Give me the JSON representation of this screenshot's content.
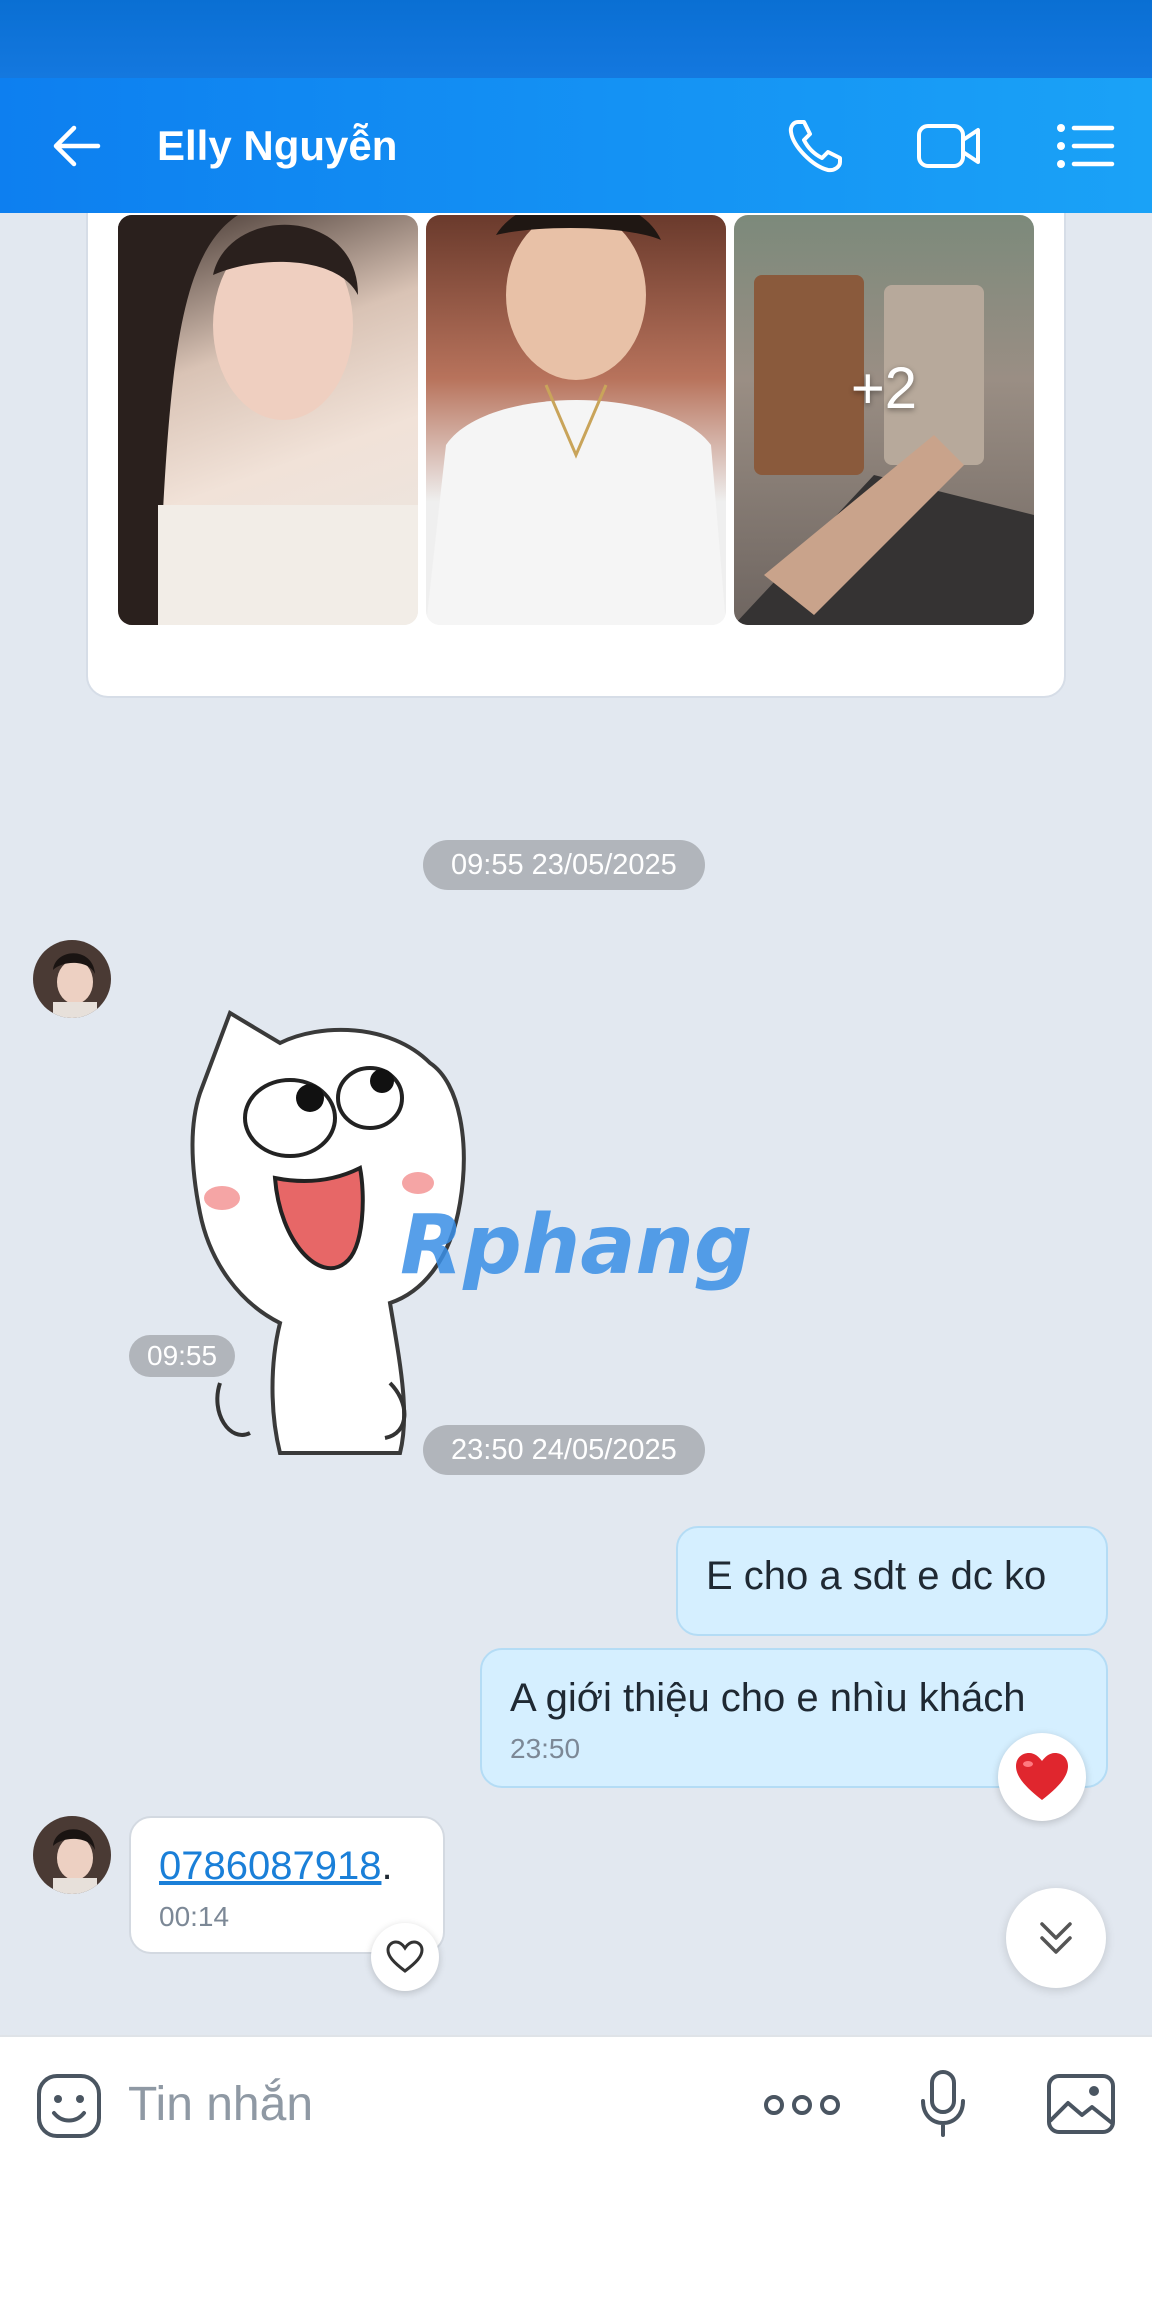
{
  "header": {
    "title": "Elly Nguyễn"
  },
  "album": {
    "more_count": "+2"
  },
  "messages": {
    "date1": "09:55 23/05/2025",
    "sticker_time": "09:55",
    "sticker_watermark": "Rphang",
    "date2": "23:50 24/05/2025",
    "out1": "E cho a sdt e dc ko",
    "out2": "A giới thiệu cho e nhìu khách",
    "out2_time": "23:50",
    "in1_link": "0786087918",
    "in1_suffix": ".",
    "in1_time": "00:14"
  },
  "input": {
    "placeholder": "Tin nhắn"
  },
  "colors": {
    "header": "#0d7ff0",
    "my_bubble": "#d5efff",
    "link": "#1a7fd8",
    "heart": "#e0262e"
  }
}
